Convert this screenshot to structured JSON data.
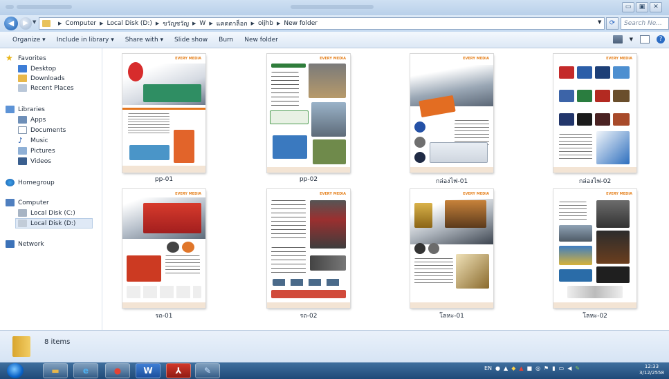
{
  "window": {
    "minimize": "▭",
    "maximize": "▣",
    "close": "✕"
  },
  "address": {
    "crumbs": [
      "Computer",
      "Local Disk (D:)",
      "ขวัญชวัญ",
      "W",
      "แคตตาล็อก",
      "oijhb",
      "New folder"
    ],
    "search_placeholder": "Search Ne..."
  },
  "toolbar": {
    "organize": "Organize ▾",
    "include": "Include in library ▾",
    "share": "Share with ▾",
    "slideshow": "Slide show",
    "burn": "Burn",
    "newfolder": "New folder"
  },
  "sidebar": {
    "favorites": "Favorites",
    "desktop": "Desktop",
    "downloads": "Downloads",
    "recent": "Recent Places",
    "libraries": "Libraries",
    "apps": "Apps",
    "documents": "Documents",
    "music": "Music",
    "pictures": "Pictures",
    "videos": "Videos",
    "homegroup": "Homegroup",
    "computer": "Computer",
    "diskc": "Local Disk (C:)",
    "diskd": "Local Disk (D:)",
    "network": "Network"
  },
  "files": [
    {
      "name": "pp-01",
      "header": "EVERY MEDIA"
    },
    {
      "name": "pp-02",
      "header": "EVERY MEDIA"
    },
    {
      "name": "กล่องไฟ-01",
      "header": "EVERY MEDIA"
    },
    {
      "name": "กล่องไฟ-02",
      "header": "EVERY MEDIA"
    },
    {
      "name": "รถ-01",
      "header": "EVERY MEDIA"
    },
    {
      "name": "รถ-02",
      "header": "EVERY MEDIA"
    },
    {
      "name": "โลหะ-01",
      "header": "EVERY MEDIA"
    },
    {
      "name": "โลหะ-02",
      "header": "EVERY MEDIA"
    }
  ],
  "details": {
    "count": "8 items"
  },
  "taskbar": {
    "lang": "EN",
    "time": "12:33",
    "date": "3/12/2558"
  }
}
